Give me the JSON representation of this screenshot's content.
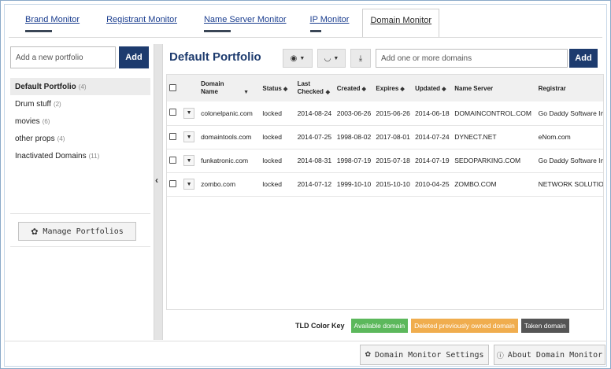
{
  "tabs": [
    {
      "label": "Brand Monitor",
      "active": false
    },
    {
      "label": "Registrant Monitor",
      "active": false
    },
    {
      "label": "Name Server Monitor",
      "active": false
    },
    {
      "label": "IP Monitor",
      "active": false
    },
    {
      "label": "Domain Monitor",
      "active": true
    }
  ],
  "sidebar": {
    "add_placeholder": "Add a new portfolio",
    "add_label": "Add",
    "portfolios": [
      {
        "name": "Default Portfolio",
        "count": "(4)",
        "selected": true
      },
      {
        "name": "Drum stuff",
        "count": "(2)",
        "selected": false
      },
      {
        "name": "movies",
        "count": "(6)",
        "selected": false
      },
      {
        "name": "other props",
        "count": "(4)",
        "selected": false
      },
      {
        "name": "Inactivated Domains",
        "count": "(11)",
        "selected": false
      }
    ],
    "manage_label": "Manage Portfolios",
    "collapse_glyph": "‹"
  },
  "main": {
    "title": "Default Portfolio",
    "view_glyph": "◉",
    "feed_glyph": "◡",
    "download_glyph": "⤓",
    "domains_placeholder": "Add one or more domains",
    "add_label": "Add",
    "columns": [
      "Domain Name",
      "Status",
      "Last Checked",
      "Created",
      "Expires",
      "Updated",
      "Name Server",
      "Registrar"
    ],
    "rows": [
      [
        "colonelpanic.com",
        "locked",
        "2014-08-24",
        "2003-06-26",
        "2015-06-26",
        "2014-06-18",
        "DOMAINCONTROL.COM",
        "Go Daddy Software Inc"
      ],
      [
        "domaintools.com",
        "locked",
        "2014-07-25",
        "1998-08-02",
        "2017-08-01",
        "2014-07-24",
        "DYNECT.NET",
        "eNom.com"
      ],
      [
        "funkatronic.com",
        "locked",
        "2014-08-31",
        "1998-07-19",
        "2015-07-18",
        "2014-07-19",
        "SEDOPARKING.COM",
        "Go Daddy Software Inc"
      ],
      [
        "zombo.com",
        "locked",
        "2014-07-12",
        "1999-10-10",
        "2015-10-10",
        "2010-04-25",
        "ZOMBO.COM",
        "NETWORK SOLUTIONS"
      ]
    ]
  },
  "color_key": {
    "label": "TLD Color Key",
    "items": [
      {
        "label": "Available domain",
        "color": "#5cb85c"
      },
      {
        "label": "Deleted previously owned domain",
        "color": "#f0ad4e"
      },
      {
        "label": "Taken domain",
        "color": "#555555"
      }
    ]
  },
  "footer": {
    "settings_label": "Domain Monitor Settings",
    "about_label": "About Domain Monitor"
  },
  "colors": {
    "brand_navy": "#1d3b6e",
    "link_blue": "#1a3d8f"
  }
}
